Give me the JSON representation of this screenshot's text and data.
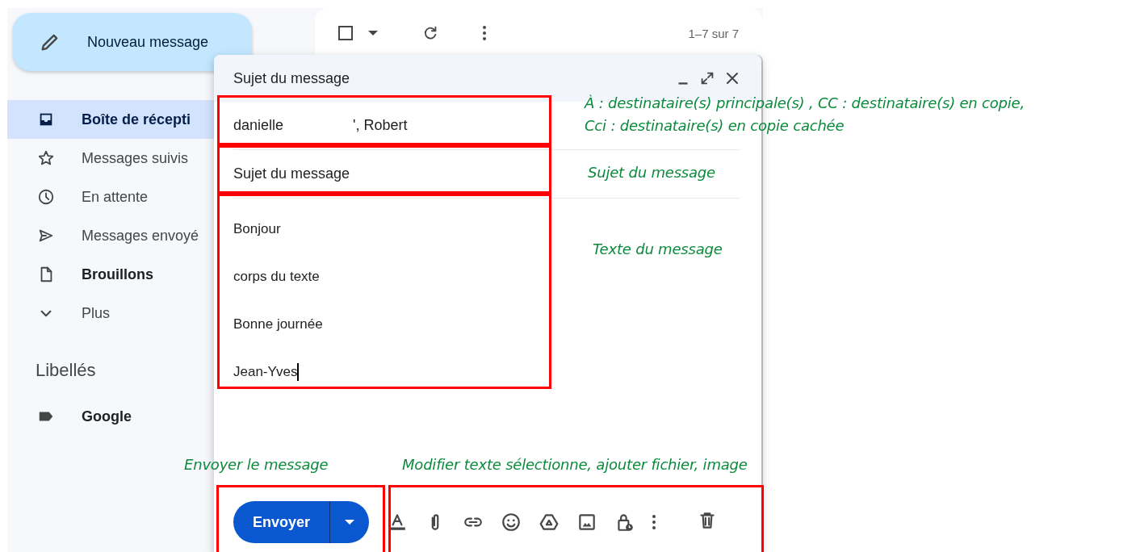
{
  "sidebar": {
    "compose_button": "Nouveau message",
    "items": [
      {
        "label": "Boîte de récepti",
        "selected": true,
        "unread": true
      },
      {
        "label": "Messages suivis",
        "selected": false,
        "unread": false
      },
      {
        "label": "En attente",
        "selected": false,
        "unread": false
      },
      {
        "label": "Messages envoyé",
        "selected": false,
        "unread": false
      },
      {
        "label": "Brouillons",
        "selected": false,
        "unread": true
      },
      {
        "label": "Plus",
        "selected": false,
        "unread": false
      }
    ],
    "labels_heading": "Libellés",
    "labels": [
      {
        "name": "Google",
        "unread": true
      }
    ]
  },
  "list_toolbar": {
    "select_all_checked": false,
    "count": "1–7 sur 7"
  },
  "compose": {
    "title": "Sujet du message",
    "recipients": [
      "danielle",
      "', Robert"
    ],
    "subject": "Sujet du message",
    "body": [
      "Bonjour",
      "corps du texte",
      "Bonne journée",
      "Jean-Yves"
    ],
    "send_label": "Envoyer"
  },
  "annotations": [
    {
      "lines": [
        "À : destinataire(s) principale(s) , CC : destinataire(s) en copie,",
        "Cci : destinataire(s) en copie cachée"
      ]
    },
    {
      "lines": [
        "Sujet du message"
      ]
    },
    {
      "lines": [
        "Texte du message"
      ]
    },
    {
      "lines": [
        "Envoyer le message"
      ]
    },
    {
      "lines": [
        "Modifier texte sélectionne, ajouter fichier, image"
      ]
    }
  ]
}
